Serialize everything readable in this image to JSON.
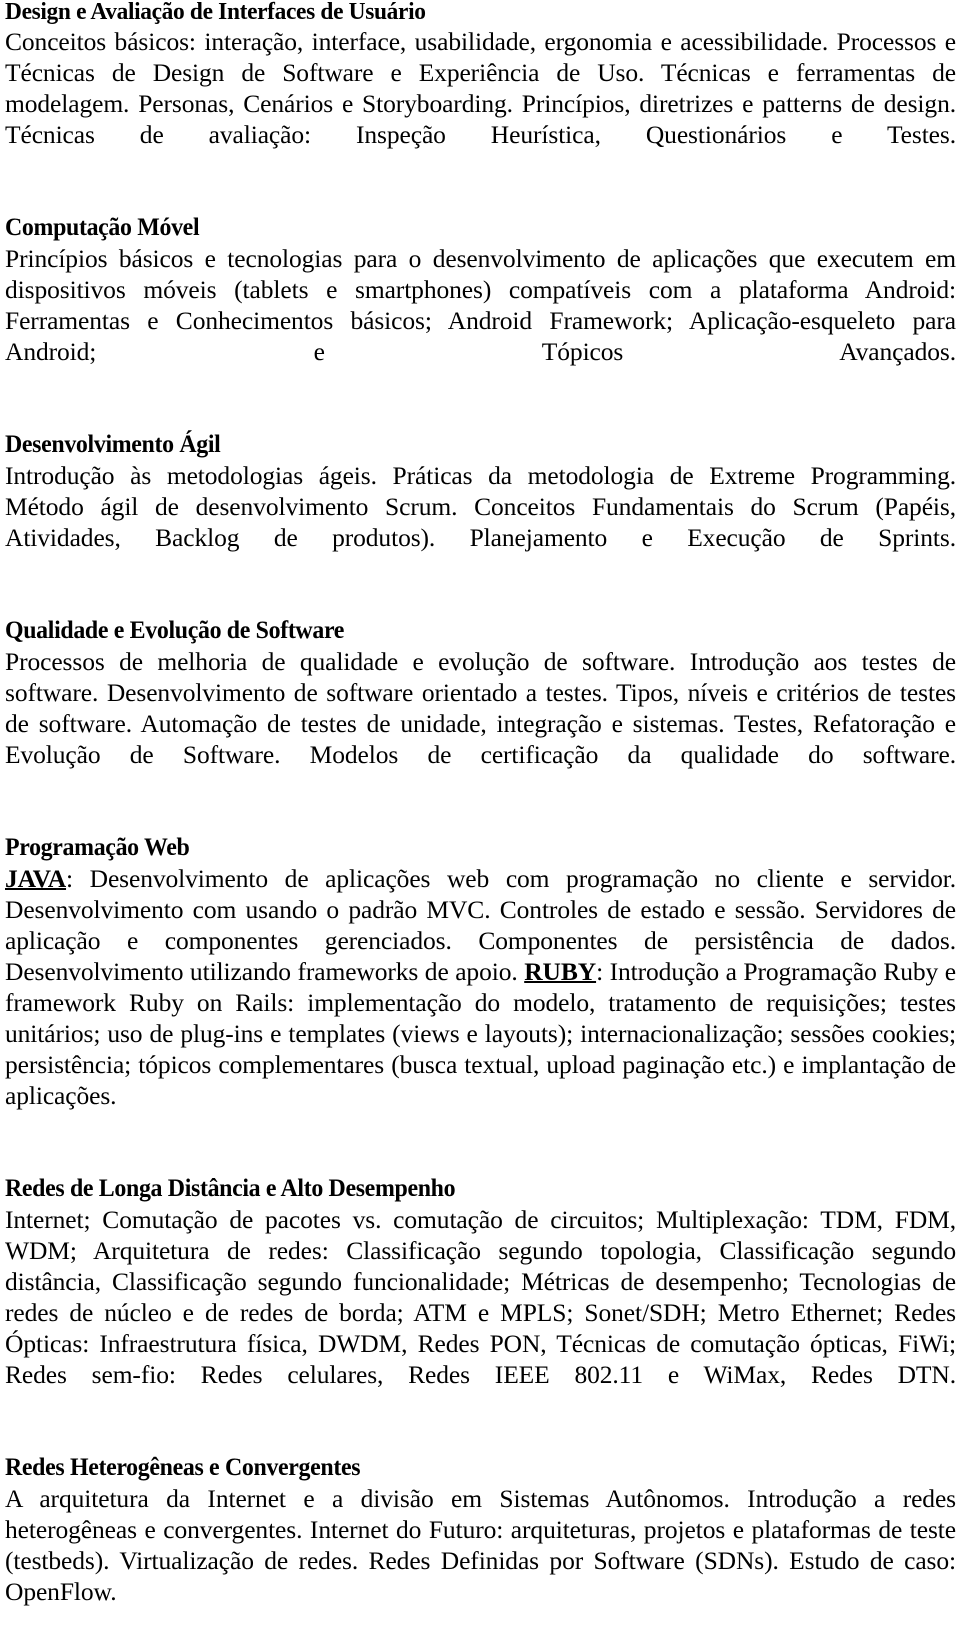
{
  "document": {
    "language": "pt-BR",
    "background_color": "#ffffff",
    "text_color": "#000000",
    "sections": [
      {
        "heading": "Design e Avaliação de Interfaces de Usuário",
        "body": "Conceitos básicos: interação, interface, usabilidade, ergonomia e acessibilidade. Processos e Técnicas de Design de Software e Experiência de Uso. Técnicas e ferramentas de modelagem. Personas, Cenários e Storyboarding. Princípios, diretrizes e patterns de design. Técnicas de avaliação: Inspeção Heurística, Questionários e Testes."
      },
      {
        "heading": "Computação Móvel",
        "body": "Princípios básicos e tecnologias para o desenvolvimento de aplicações que executem em dispositivos móveis (tablets e smartphones) compatíveis com a plataforma Android: Ferramentas e Conhecimentos básicos; Android Framework; Aplicação-esqueleto para Android; e Tópicos Avançados."
      },
      {
        "heading": "Desenvolvimento Ágil",
        "body": "Introdução às metodologias ágeis. Práticas da metodologia de Extreme Programming. Método ágil de desenvolvimento Scrum. Conceitos Fundamentais do Scrum (Papéis, Atividades, Backlog de produtos). Planejamento e Execução de Sprints."
      },
      {
        "heading": "Qualidade e Evolução de Software",
        "body": "Processos de melhoria de qualidade e evolução de software. Introdução aos testes de software. Desenvolvimento de software orientado a testes. Tipos, níveis e critérios de testes de software. Automação de testes de unidade, integração e sistemas. Testes, Refatoração e Evolução de Software. Modelos de certificação da qualidade do software."
      },
      {
        "heading": "Programação Web",
        "body_parts": [
          {
            "type": "keyword",
            "text": "JAVA"
          },
          {
            "type": "text",
            "text": ": Desenvolvimento de aplicações web com programação no cliente e servidor. Desenvolvimento com usando o padrão MVC.  Controles de estado e sessão. Servidores de aplicação e componentes gerenciados. Componentes de persistência de dados. Desenvolvimento utilizando frameworks de apoio. "
          },
          {
            "type": "keyword",
            "text": "RUBY"
          },
          {
            "type": "text",
            "text": ": Introdução a Programação Ruby e framework Ruby on Rails: implementação do modelo, tratamento de requisições; testes unitários; uso de plug-ins e templates (views e layouts); internacionalização; sessões cookies; persistência; tópicos complementares (busca textual, upload paginação etc.) e implantação de aplicações."
          }
        ]
      },
      {
        "heading": "Redes de Longa Distância e Alto Desempenho",
        "body": "Internet; Comutação de pacotes vs. comutação de circuitos; Multiplexação: TDM, FDM, WDM; Arquitetura de redes: Classificação segundo topologia, Classificação segundo distância, Classificação segundo funcionalidade; Métricas de desempenho; Tecnologias de redes de núcleo e de redes de borda; ATM e MPLS; Sonet/SDH; Metro Ethernet; Redes Ópticas: Infraestrutura física, DWDM, Redes PON, Técnicas de comutação ópticas, FiWi; Redes sem-fio: Redes celulares, Redes IEEE 802.11 e WiMax, Redes DTN."
      },
      {
        "heading": "Redes Heterogêneas e Convergentes",
        "body": "A arquitetura da Internet e a divisão em Sistemas Autônomos. Introdução a redes heterogêneas e convergentes. Internet do Futuro: arquiteturas, projetos e plataformas de teste (testbeds). Virtualização de redes. Redes Definidas por Software (SDNs). Estudo de caso: OpenFlow."
      }
    ]
  }
}
